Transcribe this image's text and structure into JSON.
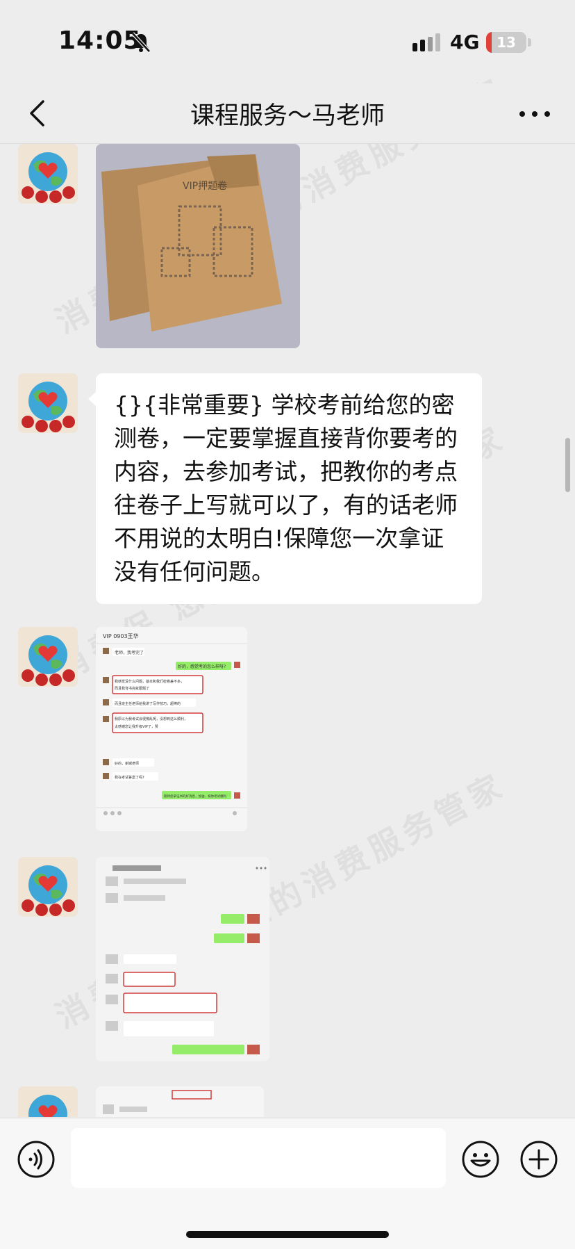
{
  "status_bar": {
    "time": "14:05",
    "network": "4G",
    "battery": "13",
    "battery_fraction": 0.13,
    "mute_icon": "bell-slash-icon",
    "signal_icon": "cell-signal-icon"
  },
  "nav": {
    "title": "课程服务～马老师",
    "back_icon": "chevron-left-icon",
    "more_icon": "ellipsis-icon"
  },
  "messages": [
    {
      "type": "image",
      "content": "photo of VIP押题卷 kraft envelopes"
    },
    {
      "type": "text",
      "content": "{}{非常重要} 学校考前给您的密测卷，一定要掌握直接背你要考的内容，去参加考试，把教你的考点往卷子上写就可以了，有的话老师不用说的太明白!保障您一次拿证没有任何问题。"
    },
    {
      "type": "image",
      "content": "chat screenshot"
    },
    {
      "type": "image",
      "content": "chat screenshot"
    },
    {
      "type": "image",
      "content": "chat screenshot (partially visible)"
    }
  ],
  "screenshot_texts": {
    "title_a": "VIP 0903王华",
    "lines": [
      "老师，我考完了",
      "好的，感觉考的怎么样呀?",
      "我感觉没什么问题，基本和我们密卷差不多，而且我背书完就跟题了",
      "而且班主任老师给我讲了写作技巧，超棒的",
      "我原以为我考试会很慌乱呢，没想到这么顺利，太感谢您让我升级VIP了，赞",
      "好的，谢谢老师",
      "我在考试答案了吗?",
      "期待您拿证书的好消息，加油，祝你考试顺利"
    ]
  },
  "watermark_text": "消费保 您身边的消费服务管家",
  "input_bar": {
    "placeholder": "",
    "voice_icon": "voice-icon",
    "emoji_icon": "smile-icon",
    "plus_icon": "plus-circle-icon"
  },
  "colors": {
    "background": "#ededed",
    "bubble": "#ffffff",
    "my_bubble": "#95ec69",
    "battery": "#e0413a",
    "highlight_box": "#d23b3b"
  }
}
